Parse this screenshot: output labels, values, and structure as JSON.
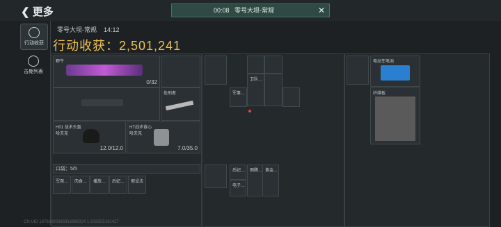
{
  "header": {
    "back_label": "更多",
    "timer": "00:08",
    "mode": "零号大坝-常规"
  },
  "sidebar": [
    {
      "label": "行动收获",
      "active": true
    },
    {
      "label": "击毙列表",
      "active": false
    }
  ],
  "summary": {
    "map": "零号大坝-常规",
    "time": "14:12",
    "title": "行动收获：",
    "value": "2,501,241"
  },
  "slots": {
    "gun1": {
      "name": "野牛",
      "sub": "0/32",
      "count": "0/32"
    },
    "knife": {
      "name": "处刑者"
    },
    "helmet": {
      "name": "H01 战术头盔",
      "sub": "哈夫克",
      "count": "12.0/12.0"
    },
    "vest": {
      "name": "HT战术背心",
      "sub": "哈夫克",
      "count_red": "7.0",
      "count_max": "/35.0"
    }
  },
  "pouch": {
    "label": "口袋：5/5"
  },
  "pouch_items": [
    "军用…",
    "肉食…",
    "播放…",
    "后妃…",
    "假设法"
  ],
  "right_items": [
    "军事…",
    "卫队…",
    "后妃…",
    "电子…",
    "图腾…",
    "黄金…",
    "军事…"
  ],
  "far_items": [
    "电动车电池",
    "纤维板"
  ],
  "footer": "CN UID 18768690386916986024 1 2028D5161427"
}
